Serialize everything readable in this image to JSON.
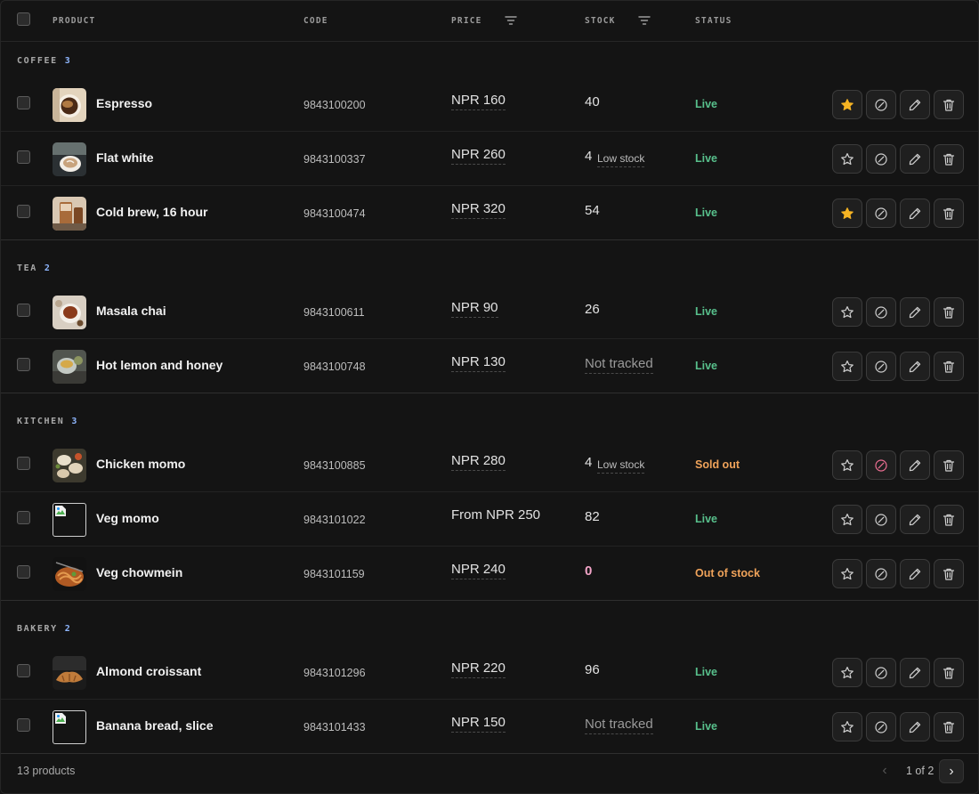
{
  "columns": {
    "product": "PRODUCT",
    "code": "CODE",
    "price": "PRICE",
    "stock": "STOCK",
    "status": "STATUS"
  },
  "icons": {
    "filter": "filter-icon",
    "star": "star-icon",
    "unavailable": "circle-slash-icon",
    "edit": "pencil-icon",
    "delete": "trash-icon"
  },
  "colors": {
    "live": "#58c08c",
    "warning": "#f0a35a",
    "star_active": "#f5b323",
    "unavailable_active": "#ee6f93",
    "zero_stock": "#f2a4c7",
    "count_badge": "#8fb7ff"
  },
  "groups": [
    {
      "name": "COFFEE",
      "count": "3",
      "rows": [
        {
          "name": "Espresso",
          "code": "9843100200",
          "price": "NPR 160",
          "stock": "40",
          "stock_note": "",
          "status": "Live",
          "status_type": "live",
          "starred": true,
          "unavailable": false,
          "thumb": "espresso"
        },
        {
          "name": "Flat white",
          "code": "9843100337",
          "price": "NPR 260",
          "stock": "4",
          "stock_note": "Low stock",
          "status": "Live",
          "status_type": "live",
          "starred": false,
          "unavailable": false,
          "thumb": "flatwhite"
        },
        {
          "name": "Cold brew, 16 hour",
          "code": "9843100474",
          "price": "NPR 320",
          "stock": "54",
          "stock_note": "",
          "status": "Live",
          "status_type": "live",
          "starred": true,
          "unavailable": false,
          "thumb": "coldbrew"
        }
      ]
    },
    {
      "name": "TEA",
      "count": "2",
      "rows": [
        {
          "name": "Masala chai",
          "code": "9843100611",
          "price": "NPR 90",
          "stock": "26",
          "stock_note": "",
          "status": "Live",
          "status_type": "live",
          "starred": false,
          "unavailable": false,
          "thumb": "chai"
        },
        {
          "name": "Hot lemon and honey",
          "code": "9843100748",
          "price": "NPR 130",
          "stock": "Not tracked",
          "stock_note": "",
          "status": "Live",
          "status_type": "live",
          "starred": false,
          "unavailable": false,
          "thumb": "lemon"
        }
      ]
    },
    {
      "name": "KITCHEN",
      "count": "3",
      "rows": [
        {
          "name": "Chicken momo",
          "code": "9843100885",
          "price": "NPR 280",
          "stock": "4",
          "stock_note": "Low stock",
          "status": "Sold out",
          "status_type": "warning",
          "starred": false,
          "unavailable": true,
          "thumb": "momo"
        },
        {
          "name": "Veg momo",
          "code": "9843101022",
          "price": "From NPR 250",
          "stock": "82",
          "stock_note": "",
          "status": "Live",
          "status_type": "live",
          "starred": false,
          "unavailable": false,
          "thumb": "broken"
        },
        {
          "name": "Veg chowmein",
          "code": "9843101159",
          "price": "NPR 240",
          "stock": "0",
          "stock_note": "",
          "status": "Out of stock",
          "status_type": "warning",
          "starred": false,
          "unavailable": false,
          "thumb": "chowmein"
        }
      ]
    },
    {
      "name": "BAKERY",
      "count": "2",
      "rows": [
        {
          "name": "Almond croissant",
          "code": "9843101296",
          "price": "NPR 220",
          "stock": "96",
          "stock_note": "",
          "status": "Live",
          "status_type": "live",
          "starred": false,
          "unavailable": false,
          "thumb": "croissant"
        },
        {
          "name": "Banana bread, slice",
          "code": "9843101433",
          "price": "NPR 150",
          "stock": "Not tracked",
          "stock_note": "",
          "status": "Live",
          "status_type": "live",
          "starred": false,
          "unavailable": false,
          "thumb": "broken"
        }
      ]
    }
  ],
  "footer": {
    "count_text": "13 products",
    "page_info": "1 of 2",
    "prev_label": "‹",
    "next_label": "›"
  }
}
